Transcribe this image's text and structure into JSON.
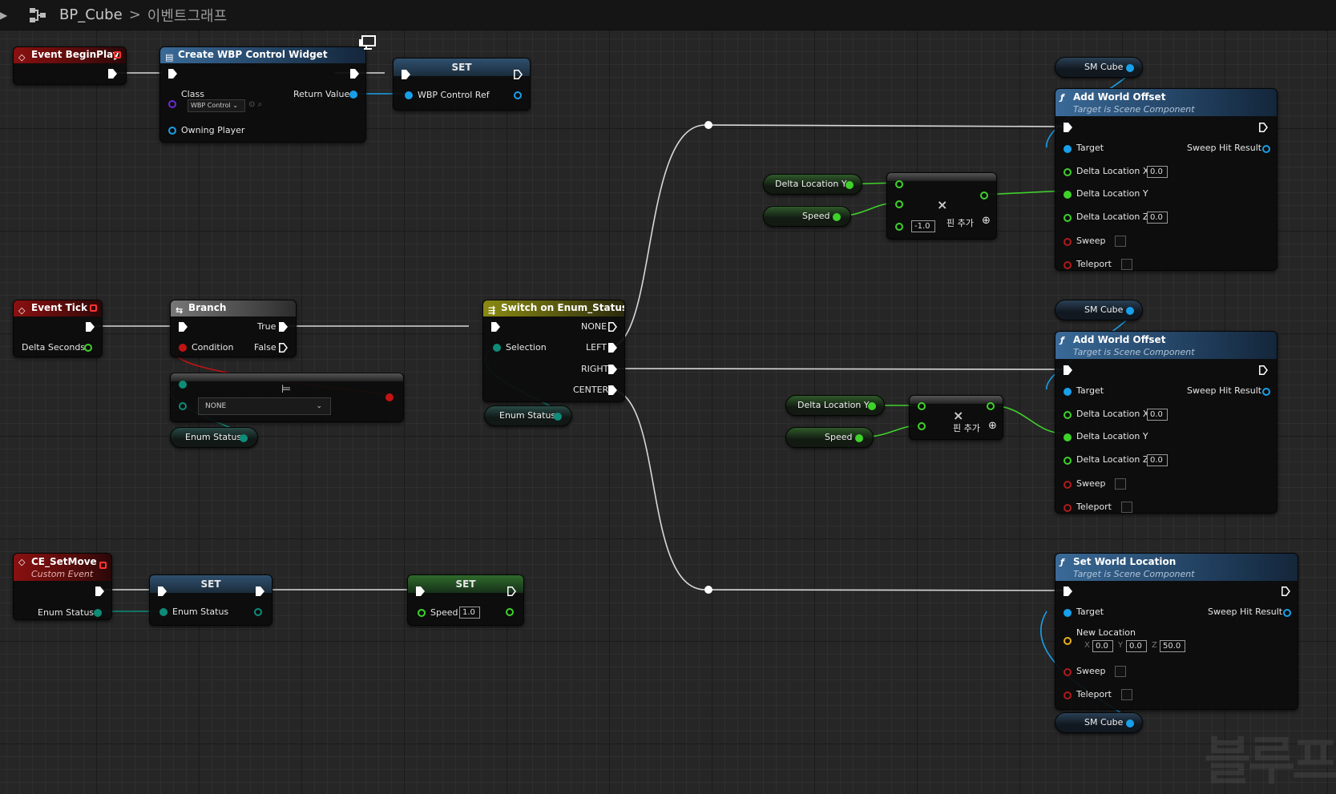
{
  "breadcrumb": {
    "blueprint": "BP_Cube",
    "separator": ">",
    "graph": "이벤트그래프"
  },
  "nodes": {
    "begin_play": {
      "title": "Event BeginPlay"
    },
    "create_widget": {
      "title": "Create WBP Control Widget",
      "class_label": "Class",
      "class_value": "WBP Control",
      "return_label": "Return Value",
      "owning_label": "Owning Player"
    },
    "set_widget": {
      "title": "SET",
      "pin": "WBP Control Ref"
    },
    "event_tick": {
      "title": "Event Tick",
      "delta": "Delta Seconds"
    },
    "branch": {
      "title": "Branch",
      "condition": "Condition",
      "true": "True",
      "false": "False"
    },
    "equal": {
      "dropdown": "NONE"
    },
    "enum_status_1": {
      "label": "Enum Status"
    },
    "switch": {
      "title": "Switch on Enum_Status",
      "selection": "Selection",
      "none": "NONE",
      "left": "LEFT",
      "right": "RIGHT",
      "center": "CENTER"
    },
    "enum_status_2": {
      "label": "Enum Status"
    },
    "sm_cube_1": {
      "label": "SM Cube"
    },
    "add_offset_1": {
      "title": "Add World Offset",
      "subtitle": "Target is Scene Component",
      "target": "Target",
      "sweep_hit": "Sweep Hit Result",
      "dx": "Delta Location X",
      "dx_val": "0.0",
      "dy": "Delta Location Y",
      "dz": "Delta Location Z",
      "dz_val": "0.0",
      "sweep": "Sweep",
      "teleport": "Teleport"
    },
    "delta_loc_y_1": {
      "label": "Delta Location Y"
    },
    "speed_1": {
      "label": "Speed"
    },
    "multiply_1": {
      "symbol": "×",
      "const": "-1.0",
      "add_pin": "핀 추가"
    },
    "sm_cube_2": {
      "label": "SM Cube"
    },
    "add_offset_2": {
      "title": "Add World Offset",
      "subtitle": "Target is Scene Component",
      "target": "Target",
      "sweep_hit": "Sweep Hit Result",
      "dx": "Delta Location X",
      "dx_val": "0.0",
      "dy": "Delta Location Y",
      "dz": "Delta Location Z",
      "dz_val": "0.0",
      "sweep": "Sweep",
      "teleport": "Teleport"
    },
    "delta_loc_y_2": {
      "label": "Delta Location Y"
    },
    "speed_2": {
      "label": "Speed"
    },
    "multiply_2": {
      "symbol": "×",
      "add_pin": "핀 추가"
    },
    "ce_setmove": {
      "title": "CE_SetMove",
      "subtitle": "Custom Event",
      "pin": "Enum Status"
    },
    "set_enum": {
      "title": "SET",
      "pin": "Enum Status"
    },
    "set_speed": {
      "title": "SET",
      "pin": "Speed",
      "value": "1.0"
    },
    "set_world_loc": {
      "title": "Set World Location",
      "subtitle": "Target is Scene Component",
      "target": "Target",
      "sweep_hit": "Sweep Hit Result",
      "new_loc": "New Location",
      "x_lbl": "X",
      "x": "0.0",
      "y_lbl": "Y",
      "y": "0.0",
      "z_lbl": "Z",
      "z": "50.0",
      "sweep": "Sweep",
      "teleport": "Teleport"
    },
    "sm_cube_3": {
      "label": "SM Cube"
    }
  },
  "watermark": "블루프",
  "colors": {
    "exec": "#ffffff",
    "object": "#18a0ea",
    "float": "#3fd22b",
    "bool": "#c01414",
    "enum": "#0e8c78",
    "vector": "#e8b01a"
  }
}
